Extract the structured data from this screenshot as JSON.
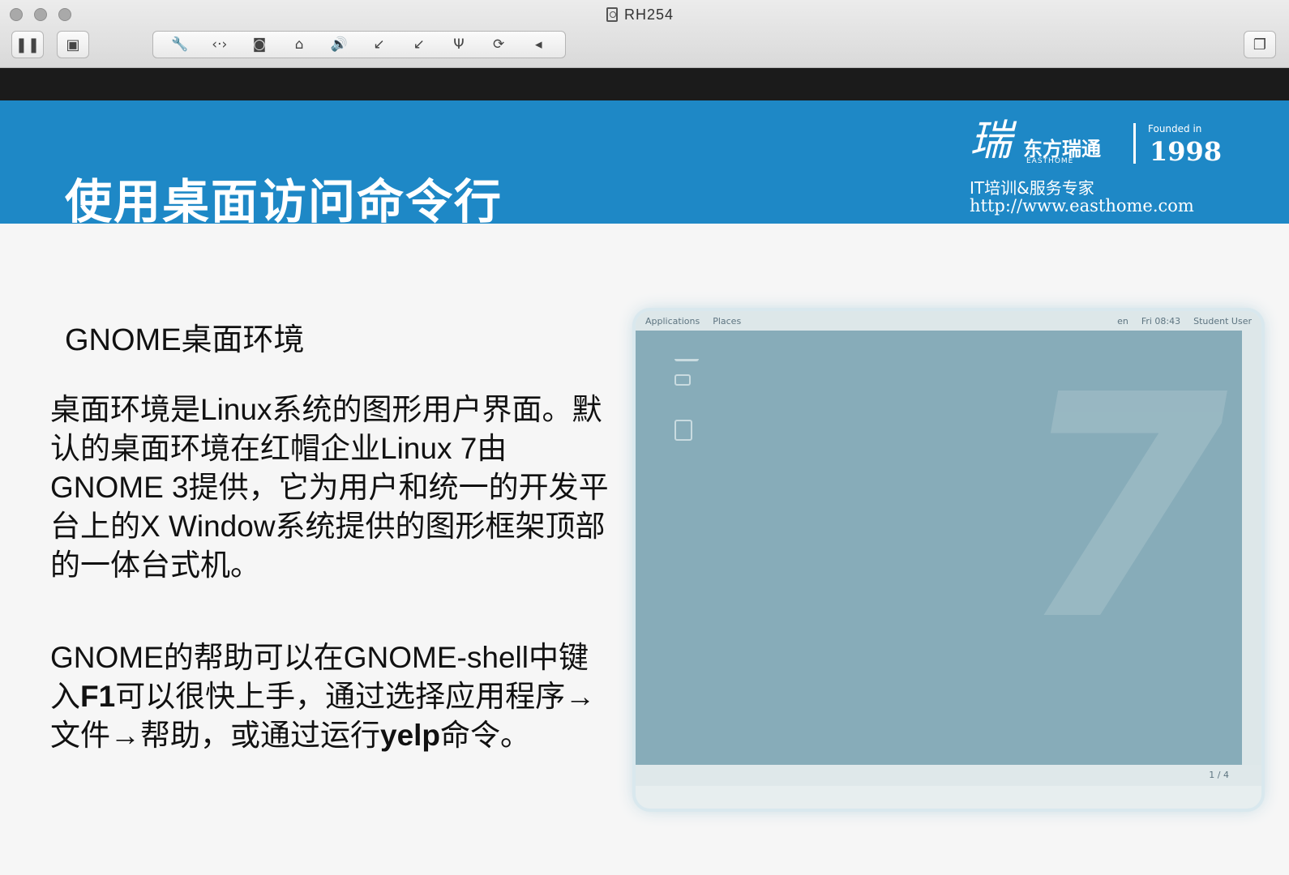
{
  "window": {
    "title": "RH254",
    "toolbar_icons": [
      "pause-icon",
      "snapshot-icon",
      "settings-wrench-icon",
      "network-arrows-icon",
      "disk-icon",
      "drive-icon",
      "volume-icon",
      "cd-icon",
      "cd-icon",
      "usb-icon",
      "sync-icon",
      "collapse-arrow-icon",
      "restore-window-icon"
    ]
  },
  "slide": {
    "title": "使用桌面访问命令行",
    "logo": {
      "mark": "瑞",
      "name": "东方瑞通",
      "sub": "EASTHOME",
      "founded": "Founded in",
      "year": "1998",
      "tagline": "IT培训&服务专家",
      "url": "http://www.easthome.com"
    },
    "subheading": "GNOME桌面环境",
    "paragraph1": "桌面环境是Linux系统的图形用户界面。默认的桌面环境在红帽企业Linux 7由GNOME 3提供，它为用户和统一的开发平台上的X Window系统提供的图形框架顶部的一体台式机。",
    "paragraph2": {
      "part1": "GNOME的帮助可以在GNOME-shell中键入",
      "bold1": "F1",
      "part2": "可以很快上手，通过选择应用程序→文件→帮助，或通过运行",
      "bold2": "yelp",
      "part3": "命令。"
    }
  },
  "screenshot": {
    "topbar_left": [
      "Applications",
      "Places"
    ],
    "topbar_right": [
      "en",
      "Fri 08:43",
      "Student User"
    ],
    "bottom_pager": "1 / 4",
    "wallpaper_number": "7"
  },
  "colors": {
    "header_blue": "#1e88c6",
    "black_bar": "#1b1b1b",
    "desktop_bg": "#87acb9"
  }
}
